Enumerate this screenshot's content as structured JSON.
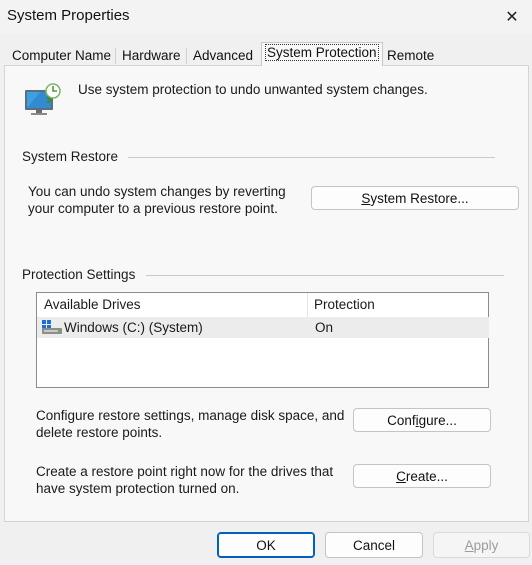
{
  "window": {
    "title": "System Properties",
    "close_glyph": "✕"
  },
  "tabs": [
    {
      "label": "Computer Name"
    },
    {
      "label": "Hardware"
    },
    {
      "label": "Advanced"
    },
    {
      "label": "System Protection",
      "active": true
    },
    {
      "label": "Remote"
    }
  ],
  "intro": {
    "icon": "system-protection-icon",
    "text": "Use system protection to undo unwanted system changes."
  },
  "system_restore": {
    "group_label": "System Restore",
    "description_line1": "You can undo system changes by reverting",
    "description_line2": "your computer to a previous restore point.",
    "button_mnemonic": "S",
    "button_rest": "ystem Restore..."
  },
  "protection_settings": {
    "group_label": "Protection Settings",
    "columns": [
      "Available Drives",
      "Protection"
    ],
    "drives": [
      {
        "icon": "drive-icon",
        "name": "Windows (C:) (System)",
        "protection": "On"
      }
    ],
    "configure_text_line1": "Configure restore settings, manage disk space, and",
    "configure_text_line2": "delete restore points.",
    "configure_pre": "Conf",
    "configure_mnemonic": "i",
    "configure_post": "gure...",
    "create_text_line1": "Create a restore point right now for the drives that",
    "create_text_line2": "have system protection turned on.",
    "create_mnemonic": "C",
    "create_rest": "reate..."
  },
  "footer": {
    "ok_label": "OK",
    "cancel_label": "Cancel",
    "apply_mnemonic": "A",
    "apply_rest": "pply"
  },
  "colors": {
    "accent": "#005fb8",
    "panel": "#f8f8f8",
    "window": "#f0f0f0"
  }
}
